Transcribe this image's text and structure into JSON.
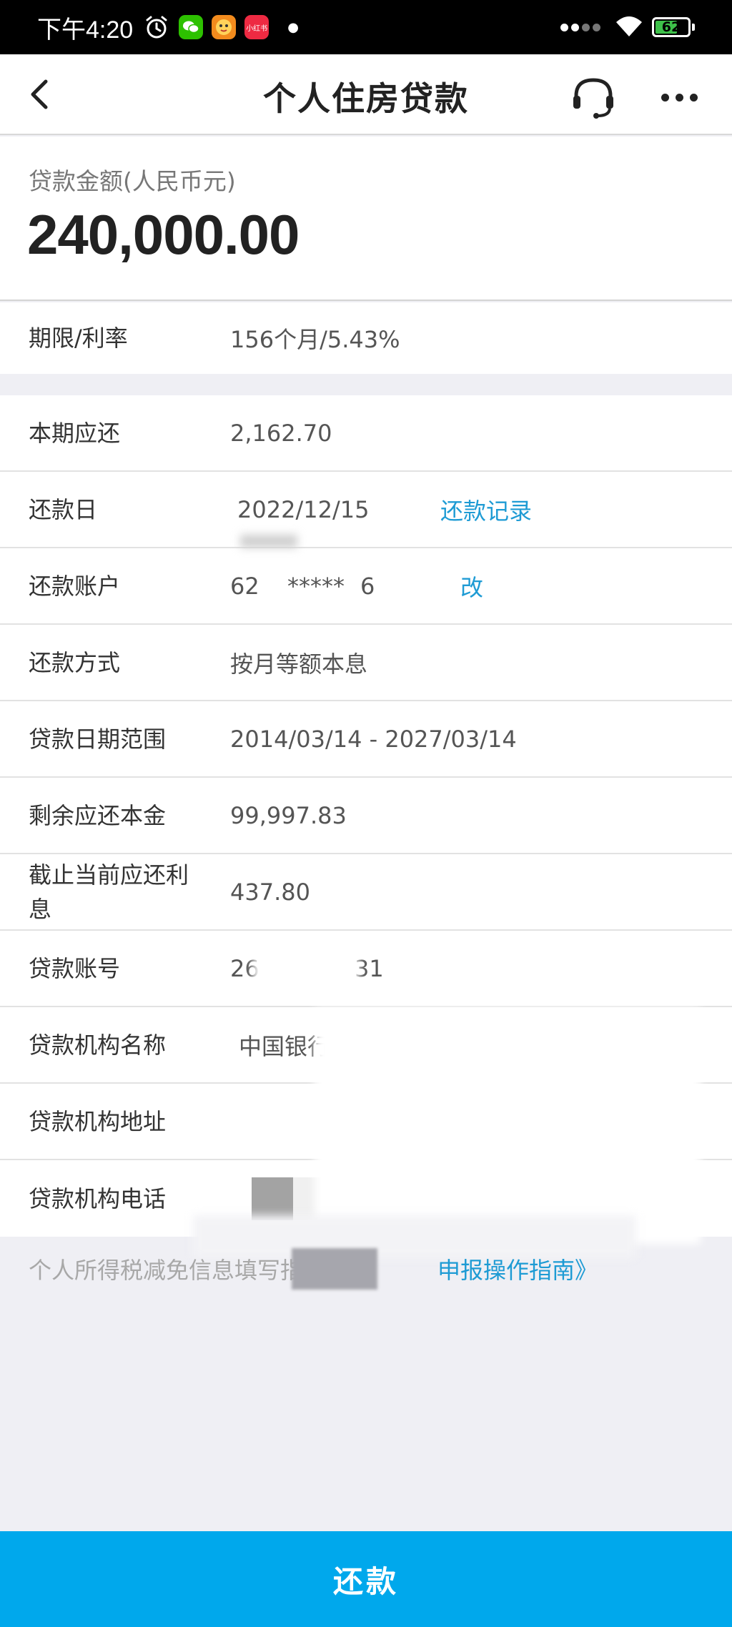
{
  "status_bar": {
    "time": "下午4:20",
    "battery": "62",
    "apps": [
      {
        "name": "wechat-icon",
        "color": "#2dc100"
      },
      {
        "name": "lion-app-icon",
        "color": "#f28b1d"
      },
      {
        "name": "xiaohongshu-icon",
        "color": "#ee2a42",
        "text": "小红书"
      }
    ]
  },
  "nav": {
    "title": "个人住房贷款"
  },
  "amount": {
    "label": "贷款金额(人民币元)",
    "value": "240,000.00"
  },
  "rows_top": [
    {
      "label": "期限/利率",
      "value": "156个月/5.43%"
    }
  ],
  "rows_main": [
    {
      "label": "本期应还",
      "value": "2,162.70"
    },
    {
      "label": "还款日",
      "value": "2022/12/15",
      "link": "还款记录"
    },
    {
      "label": "还款账户",
      "value": "62",
      "value_part2": "*****",
      "value_part3": "6",
      "link": "改"
    },
    {
      "label": "还款方式",
      "value": "按月等额本息"
    },
    {
      "label": "贷款日期范围",
      "value": "2014/03/14 - 2027/03/14"
    },
    {
      "label": "剩余应还本金",
      "value": "99,997.83"
    },
    {
      "label": "截止当前应还利息",
      "value": "437.80"
    },
    {
      "label": "贷款账号",
      "value": "26",
      "value_part2": "31"
    },
    {
      "label": "贷款机构名称",
      "value": "中国银行"
    },
    {
      "label": "贷款机构地址",
      "value": ""
    },
    {
      "label": "贷款机构电话",
      "value": ""
    }
  ],
  "footer": {
    "tax_note": "个人所得税减免信息填写指引",
    "tax_link": "申报操作指南》"
  },
  "repay_button": "还款",
  "colors": {
    "accent": "#00a8ec",
    "link": "#1e9bd4",
    "background": "#efeff4"
  }
}
